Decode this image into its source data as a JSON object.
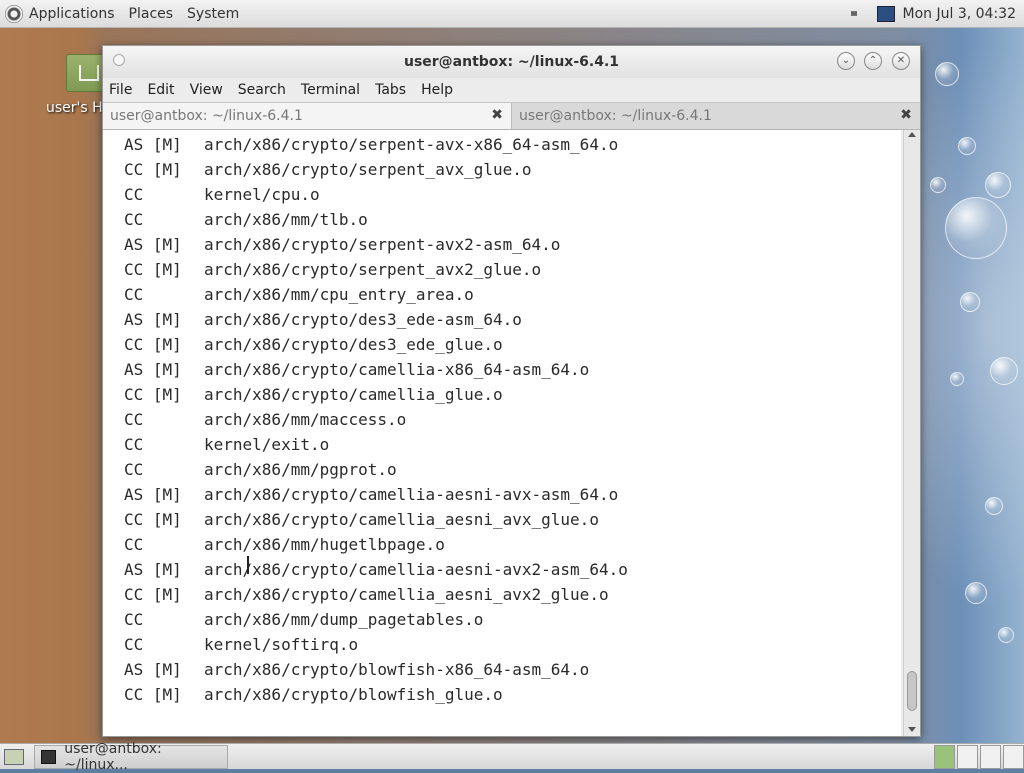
{
  "top_panel": {
    "menus": [
      "Applications",
      "Places",
      "System"
    ],
    "clock": "Mon Jul 3, 04:32",
    "icons": [
      "volume-icon",
      "network-icon"
    ]
  },
  "desktop": {
    "icon_label": "user's H"
  },
  "window": {
    "title": "user@antbox: ~/linux-6.4.1",
    "menu": [
      "File",
      "Edit",
      "View",
      "Search",
      "Terminal",
      "Tabs",
      "Help"
    ],
    "tabs": [
      {
        "label": "user@antbox: ~/linux-6.4.1",
        "active": true
      },
      {
        "label": "user@antbox: ~/linux-6.4.1",
        "active": false
      }
    ]
  },
  "terminal": {
    "lines": [
      {
        "cmd": "AS [M]",
        "path": "arch/x86/crypto/serpent-avx-x86_64-asm_64.o"
      },
      {
        "cmd": "CC [M]",
        "path": "arch/x86/crypto/serpent_avx_glue.o"
      },
      {
        "cmd": "CC",
        "path": "kernel/cpu.o"
      },
      {
        "cmd": "CC",
        "path": "arch/x86/mm/tlb.o"
      },
      {
        "cmd": "AS [M]",
        "path": "arch/x86/crypto/serpent-avx2-asm_64.o"
      },
      {
        "cmd": "CC [M]",
        "path": "arch/x86/crypto/serpent_avx2_glue.o"
      },
      {
        "cmd": "CC",
        "path": "arch/x86/mm/cpu_entry_area.o"
      },
      {
        "cmd": "AS [M]",
        "path": "arch/x86/crypto/des3_ede-asm_64.o"
      },
      {
        "cmd": "CC [M]",
        "path": "arch/x86/crypto/des3_ede_glue.o"
      },
      {
        "cmd": "AS [M]",
        "path": "arch/x86/crypto/camellia-x86_64-asm_64.o"
      },
      {
        "cmd": "CC [M]",
        "path": "arch/x86/crypto/camellia_glue.o"
      },
      {
        "cmd": "CC",
        "path": "arch/x86/mm/maccess.o"
      },
      {
        "cmd": "CC",
        "path": "kernel/exit.o"
      },
      {
        "cmd": "CC",
        "path": "arch/x86/mm/pgprot.o"
      },
      {
        "cmd": "AS [M]",
        "path": "arch/x86/crypto/camellia-aesni-avx-asm_64.o"
      },
      {
        "cmd": "CC [M]",
        "path": "arch/x86/crypto/camellia_aesni_avx_glue.o"
      },
      {
        "cmd": "CC",
        "path": "arch/x86/mm/hugetlbpage.o"
      },
      {
        "cmd": "AS [M]",
        "path": "arch/x86/crypto/camellia-aesni-avx2-asm_64.o"
      },
      {
        "cmd": "CC [M]",
        "path": "arch/x86/crypto/camellia_aesni_avx2_glue.o"
      },
      {
        "cmd": "CC",
        "path": "arch/x86/mm/dump_pagetables.o"
      },
      {
        "cmd": "CC",
        "path": "kernel/softirq.o"
      },
      {
        "cmd": "AS [M]",
        "path": "arch/x86/crypto/blowfish-x86_64-asm_64.o"
      },
      {
        "cmd": "CC [M]",
        "path": "arch/x86/crypto/blowfish_glue.o"
      }
    ]
  },
  "taskbar": {
    "task_label": "user@antbox: ~/linux...",
    "workspaces": 4,
    "active_workspace": 1
  }
}
